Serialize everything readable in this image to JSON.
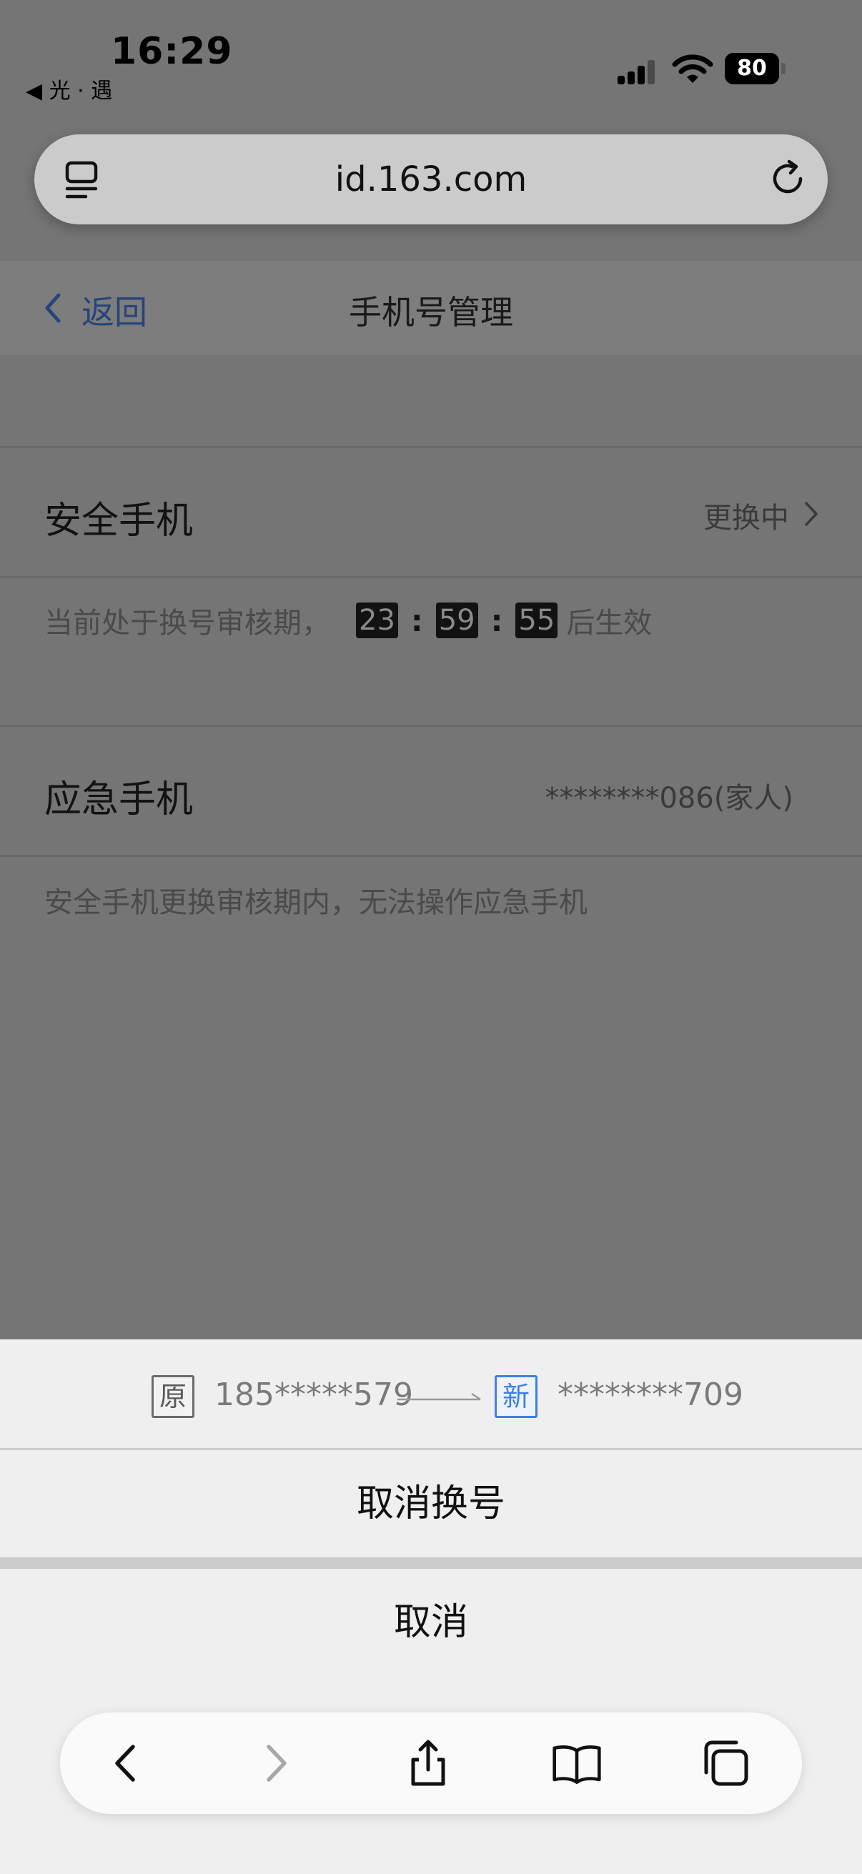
{
  "status_bar": {
    "time": "16:29",
    "back_app": "◀ 光 · 遇",
    "battery": "80"
  },
  "browser": {
    "url": "id.163.com"
  },
  "header": {
    "back_label": "返回",
    "title": "手机号管理"
  },
  "security_phone": {
    "label": "安全手机",
    "status": "更换中",
    "note_prefix": "当前处于换号审核期，",
    "countdown": {
      "hours": "23",
      "minutes": "59",
      "seconds": "55"
    },
    "separator": ":",
    "note_suffix": "后生效"
  },
  "emergency_phone": {
    "label": "应急手机",
    "value": "********086(家人)",
    "note": "安全手机更换审核期内，无法操作应急手机"
  },
  "action_sheet": {
    "old_badge": "原",
    "old_number": "185*****579",
    "new_badge": "新",
    "new_number": "********709",
    "cancel_change": "取消换号",
    "cancel": "取消"
  },
  "colors": {
    "link_blue": "#27457a",
    "new_badge_blue": "#3d80e6"
  },
  "toolbar": {
    "icons": [
      "back-icon",
      "forward-icon",
      "share-icon",
      "bookmarks-icon",
      "tabs-icon"
    ]
  }
}
